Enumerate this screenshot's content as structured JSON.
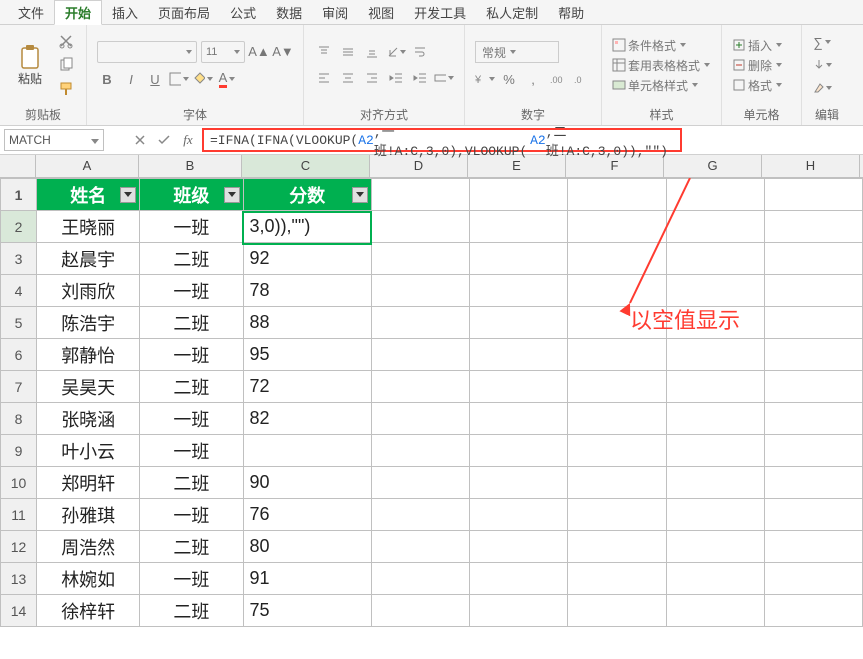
{
  "menu": {
    "items": [
      "文件",
      "开始",
      "插入",
      "页面布局",
      "公式",
      "数据",
      "审阅",
      "视图",
      "开发工具",
      "私人定制",
      "帮助"
    ],
    "active_index": 1
  },
  "ribbon_groups": {
    "clipboard": {
      "paste": "粘贴",
      "label": "剪贴板"
    },
    "font": {
      "label": "字体"
    },
    "alignment": {
      "label": "对齐方式"
    },
    "number": {
      "format": "常规",
      "label": "数字"
    },
    "styles": {
      "condfmt": "条件格式",
      "tablefmt": "套用表格格式",
      "cellfmt": "单元格样式",
      "label": "样式"
    },
    "cells": {
      "insert": "插入",
      "delete": "删除",
      "format": "格式",
      "label": "单元格"
    },
    "editing": {
      "label": "编辑"
    }
  },
  "namebox": "MATCH",
  "formula": {
    "t1": "=IFNA(IFNA(VLOOKUP(",
    "r1": "A2",
    "t2": ",一班!A:C,3,0),VLOOKUP(",
    "r2": "A2",
    "t3": ",二班!A:C,3,0)),\"\")"
  },
  "columns": [
    "A",
    "B",
    "C",
    "D",
    "E",
    "F",
    "G",
    "H"
  ],
  "table": {
    "headers": [
      "姓名",
      "班级",
      "分数"
    ],
    "rows": [
      {
        "n": "王晓丽",
        "c": "一班",
        "s": "3,0)),\"\")"
      },
      {
        "n": "赵晨宇",
        "c": "二班",
        "s": "92"
      },
      {
        "n": "刘雨欣",
        "c": "一班",
        "s": "78"
      },
      {
        "n": "陈浩宇",
        "c": "二班",
        "s": "88"
      },
      {
        "n": "郭静怡",
        "c": "一班",
        "s": "95"
      },
      {
        "n": "吴昊天",
        "c": "二班",
        "s": "72"
      },
      {
        "n": "张晓涵",
        "c": "一班",
        "s": "82"
      },
      {
        "n": "叶小云",
        "c": "一班",
        "s": ""
      },
      {
        "n": "郑明轩",
        "c": "二班",
        "s": "90"
      },
      {
        "n": "孙雅琪",
        "c": "一班",
        "s": "76"
      },
      {
        "n": "周浩然",
        "c": "二班",
        "s": "80"
      },
      {
        "n": "林婉如",
        "c": "一班",
        "s": "91"
      },
      {
        "n": "徐梓轩",
        "c": "二班",
        "s": "75"
      }
    ]
  },
  "annotation": "以空值显示"
}
